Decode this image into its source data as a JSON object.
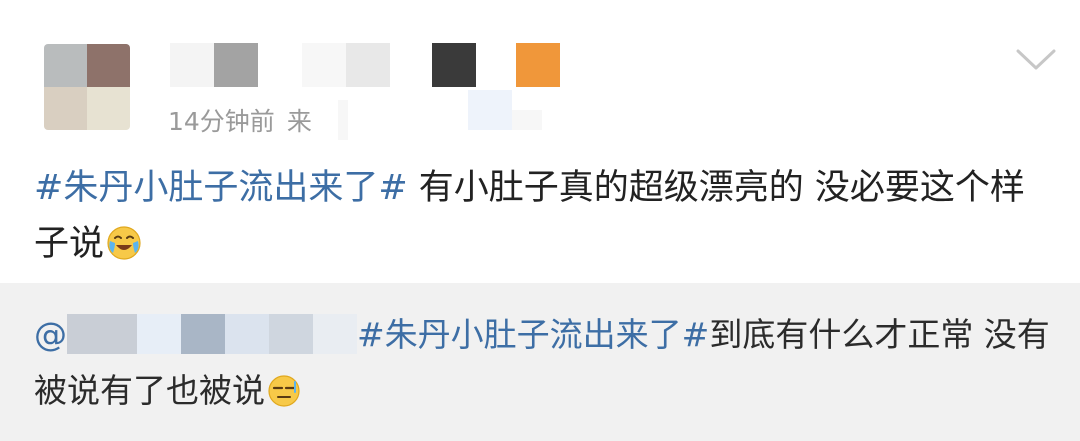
{
  "post": {
    "timestamp": "14分钟前",
    "source_prefix": "来",
    "hashtag": "#朱丹小肚子流出来了#",
    "body": " 有小肚子真的超级漂亮的 没必要这个样子说",
    "body_emoji": "crying-laughing-emoji",
    "expand_icon": "chevron-down-icon"
  },
  "repost": {
    "user_prefix": "@",
    "hashtag": "#朱丹小肚子流出来了#",
    "body": "到底有什么才正常 没有被说有了也被说",
    "body_emoji": "speechless-emoji"
  },
  "colors": {
    "topic_link": "#3d6ea5",
    "meta_text": "#9a9a9a",
    "body_text": "#222222",
    "repost_bg": "#f1f1f1"
  }
}
